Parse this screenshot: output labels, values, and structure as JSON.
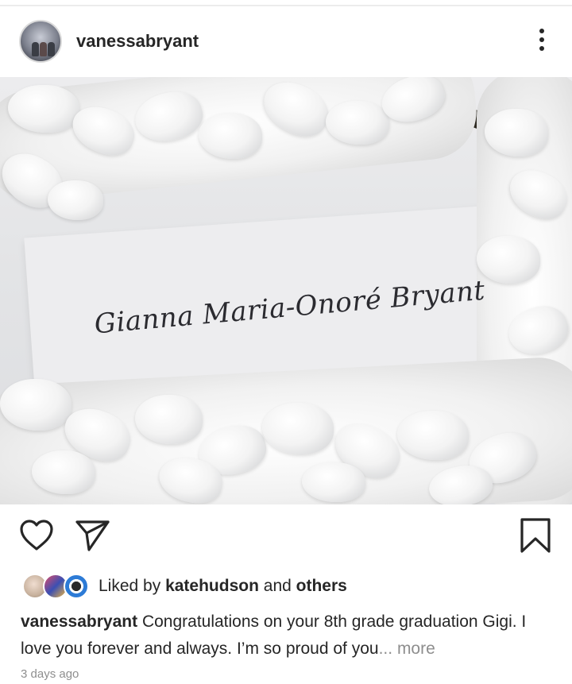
{
  "post": {
    "username": "vanessabryant",
    "photo": {
      "name_on_card": "Gianna Maria-Onoré Bryant"
    },
    "likes": {
      "prefix": "Liked by",
      "user": "katehudson",
      "conjunction": "and",
      "suffix": "others"
    },
    "caption": {
      "username": "vanessabryant",
      "text": "Congratulations on your 8th grade graduation Gigi. I love you forever and always. I’m so proud of you",
      "ellipsis": "...",
      "more_label": "more"
    },
    "timestamp": "3 days ago"
  },
  "icons": {
    "more": "more-vertical-icon",
    "like": "heart-outline-icon",
    "share": "paper-plane-icon",
    "save": "bookmark-outline-icon"
  },
  "colors": {
    "text": "#262626",
    "secondary": "#8e8e8e",
    "background": "#ffffff"
  }
}
